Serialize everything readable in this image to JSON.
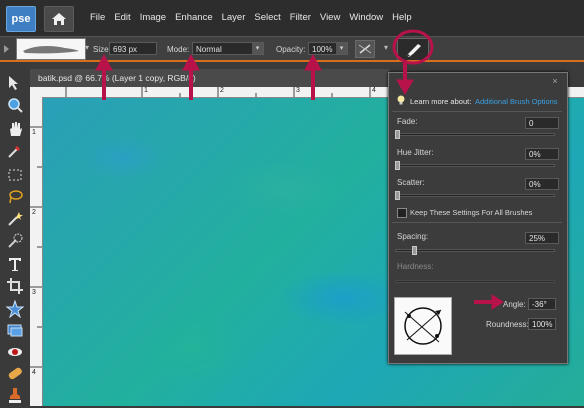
{
  "app": {
    "logo_text": "pse"
  },
  "menu": [
    "File",
    "Edit",
    "Image",
    "Enhance",
    "Layer",
    "Select",
    "Filter",
    "View",
    "Window",
    "Help"
  ],
  "options_bar": {
    "size_label": "Size:",
    "size_value": "693 px",
    "mode_label": "Mode:",
    "mode_value": "Normal",
    "opacity_label": "Opacity:",
    "opacity_value": "100%"
  },
  "document": {
    "tab_title": "batik.psd @ 66.7% (Layer 1 copy, RGB/8)"
  },
  "rulers": {
    "top_ticks": [
      "1",
      "2",
      "3",
      "4",
      "5"
    ],
    "left_ticks": [
      "1",
      "2",
      "3",
      "4",
      "5"
    ]
  },
  "brush_panel": {
    "learn_more_text": "Learn more about:",
    "learn_more_link": "Additional Brush Options",
    "fade_label": "Fade:",
    "fade_value": "0",
    "hue_jitter_label": "Hue Jitter:",
    "hue_jitter_value": "0%",
    "scatter_label": "Scatter:",
    "scatter_value": "0%",
    "keep_settings_label": "Keep These Settings For All Brushes",
    "spacing_label": "Spacing:",
    "spacing_value": "25%",
    "hardness_label": "Hardness:",
    "angle_label": "Angle:",
    "angle_value": "-36°",
    "roundness_label": "Roundness:",
    "roundness_value": "100%",
    "close_icon": "×"
  },
  "colors": {
    "accent_orange": "#d96d1e",
    "annotation": "#b8124b",
    "link_blue": "#3a9fe0",
    "canvas_teal": "#22ab9f"
  }
}
